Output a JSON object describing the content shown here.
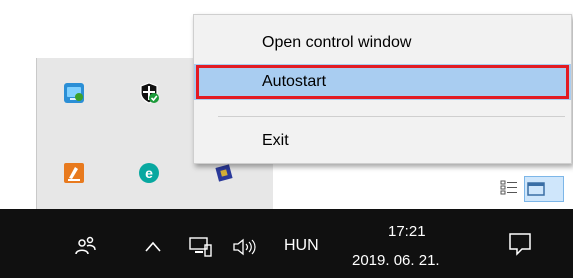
{
  "context_menu": {
    "items": [
      {
        "label": "Open control window"
      },
      {
        "label": "Autostart",
        "selected": true
      },
      {
        "label": "Exit"
      }
    ],
    "highlight_color": "#a9cdf1",
    "selection_border_color": "#e31b23"
  },
  "tray_flyout": {
    "icons": [
      {
        "name": "network-monitor-icon"
      },
      {
        "name": "windows-security-icon"
      },
      {
        "name": "editor-app-icon"
      },
      {
        "name": "eset-icon"
      },
      {
        "name": "chip-icon"
      }
    ]
  },
  "taskbar": {
    "language": "HUN",
    "time": "17:21",
    "date": "2019. 06. 21.",
    "background": "#101010"
  }
}
